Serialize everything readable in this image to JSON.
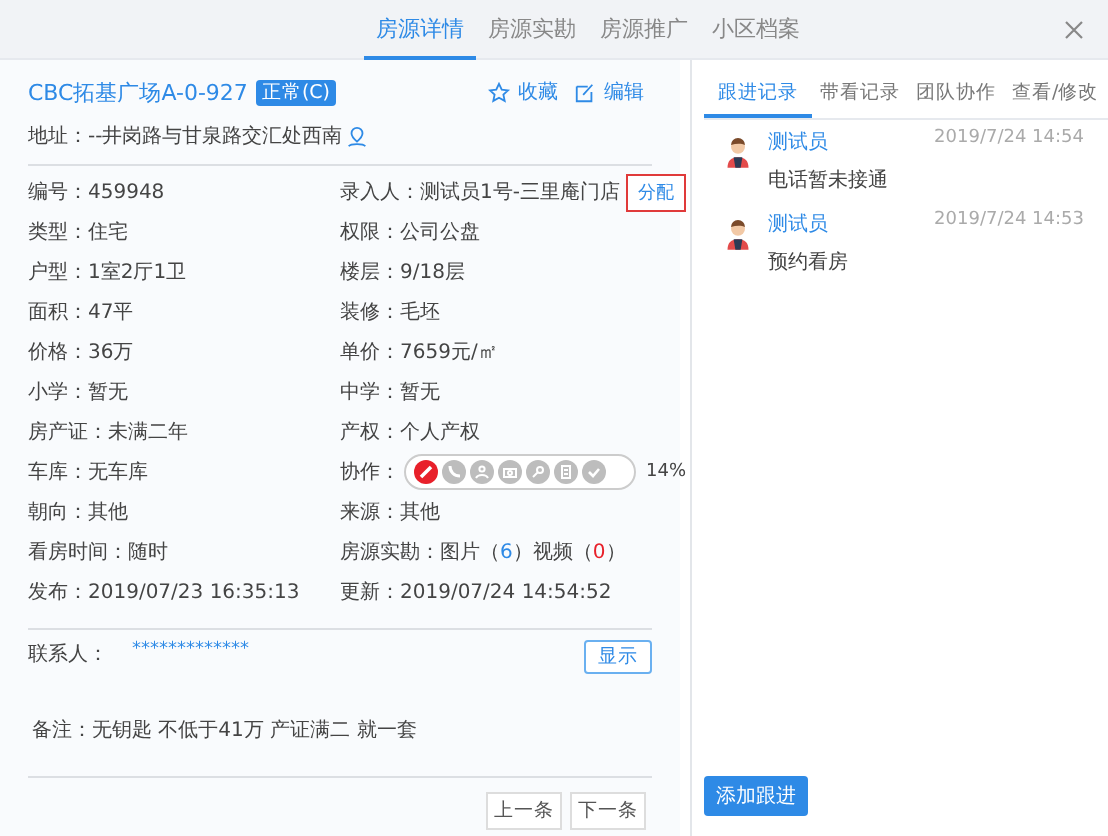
{
  "tabs": [
    {
      "label": "房源详情",
      "selected": true
    },
    {
      "label": "房源实勘",
      "selected": false
    },
    {
      "label": "房源推广",
      "selected": false
    },
    {
      "label": "小区档案",
      "selected": false
    }
  ],
  "house": {
    "title": "CBC拓基广场A-0-927",
    "status": "正常(C)",
    "favorite": "收藏",
    "edit": "编辑",
    "address": "地址：--井岗路与甘泉路交汇处西南"
  },
  "rows": [
    {
      "left": {
        "kind": "text",
        "text": "编号：459948"
      },
      "right": {
        "kind": "assign",
        "text": "录入人：测试员1号-三里庵门店",
        "button": "分配"
      }
    },
    {
      "left": {
        "kind": "text",
        "text": "类型：住宅"
      },
      "right": {
        "kind": "text",
        "text": "权限：公司公盘"
      }
    },
    {
      "left": {
        "kind": "text",
        "text": "户型：1室2厅1卫"
      },
      "right": {
        "kind": "text",
        "text": "楼层：9/18层"
      }
    },
    {
      "left": {
        "kind": "text",
        "text": "面积：47平"
      },
      "right": {
        "kind": "text",
        "text": "装修：毛坯"
      }
    },
    {
      "left": {
        "kind": "text",
        "text": "价格：36万"
      },
      "right": {
        "kind": "text",
        "text": "单价：7659元/㎡"
      }
    },
    {
      "left": {
        "kind": "text",
        "text": "小学：暂无"
      },
      "right": {
        "kind": "text",
        "text": "中学：暂无"
      }
    },
    {
      "left": {
        "kind": "text",
        "text": "房产证：未满二年"
      },
      "right": {
        "kind": "text",
        "text": "产权：个人产权"
      }
    },
    {
      "left": {
        "kind": "text",
        "text": "车库：无车库"
      },
      "right": {
        "kind": "collab",
        "text": "协作：",
        "percent": "14%",
        "steps": [
          {
            "kind": "pen",
            "on": true
          },
          {
            "kind": "phone",
            "on": false
          },
          {
            "kind": "person",
            "on": false
          },
          {
            "kind": "camera",
            "on": false
          },
          {
            "kind": "key",
            "on": false
          },
          {
            "kind": "document",
            "on": false
          },
          {
            "kind": "check",
            "on": false
          }
        ]
      }
    },
    {
      "left": {
        "kind": "text",
        "text": "朝向：其他"
      },
      "right": {
        "kind": "text",
        "text": "来源：其他"
      }
    },
    {
      "left": {
        "kind": "text",
        "text": "看房时间：随时"
      },
      "right": {
        "kind": "media",
        "text": "房源实勘：",
        "photo_label": "图片（",
        "photos": "6",
        "photo_end": "）",
        "video_label": "视频（",
        "videos": "0",
        "video_end": "）"
      }
    },
    {
      "left": {
        "kind": "text",
        "text": "发布：2019/07/23 16:35:13"
      },
      "right": {
        "kind": "text",
        "text": "更新：2019/07/24 14:54:52"
      }
    }
  ],
  "contact": {
    "label": "联系人：",
    "value": "*************",
    "button": "显示"
  },
  "remark": "备注：无钥匙 不低于41万 产证满二 就一套",
  "pager": [
    "上一条",
    "下一条"
  ],
  "side_tabs": [
    {
      "label": "跟进记录",
      "selected": true
    },
    {
      "label": "带看记录",
      "selected": false
    },
    {
      "label": "团队协作",
      "selected": false
    },
    {
      "label": "查看/修改",
      "selected": false
    }
  ],
  "records": [
    {
      "name": "测试员",
      "time": "2019/7/24 14:54",
      "text": "电话暂未接通"
    },
    {
      "name": "测试员",
      "time": "2019/7/24 14:53",
      "text": "预约看房"
    }
  ],
  "add_button": "添加跟进"
}
